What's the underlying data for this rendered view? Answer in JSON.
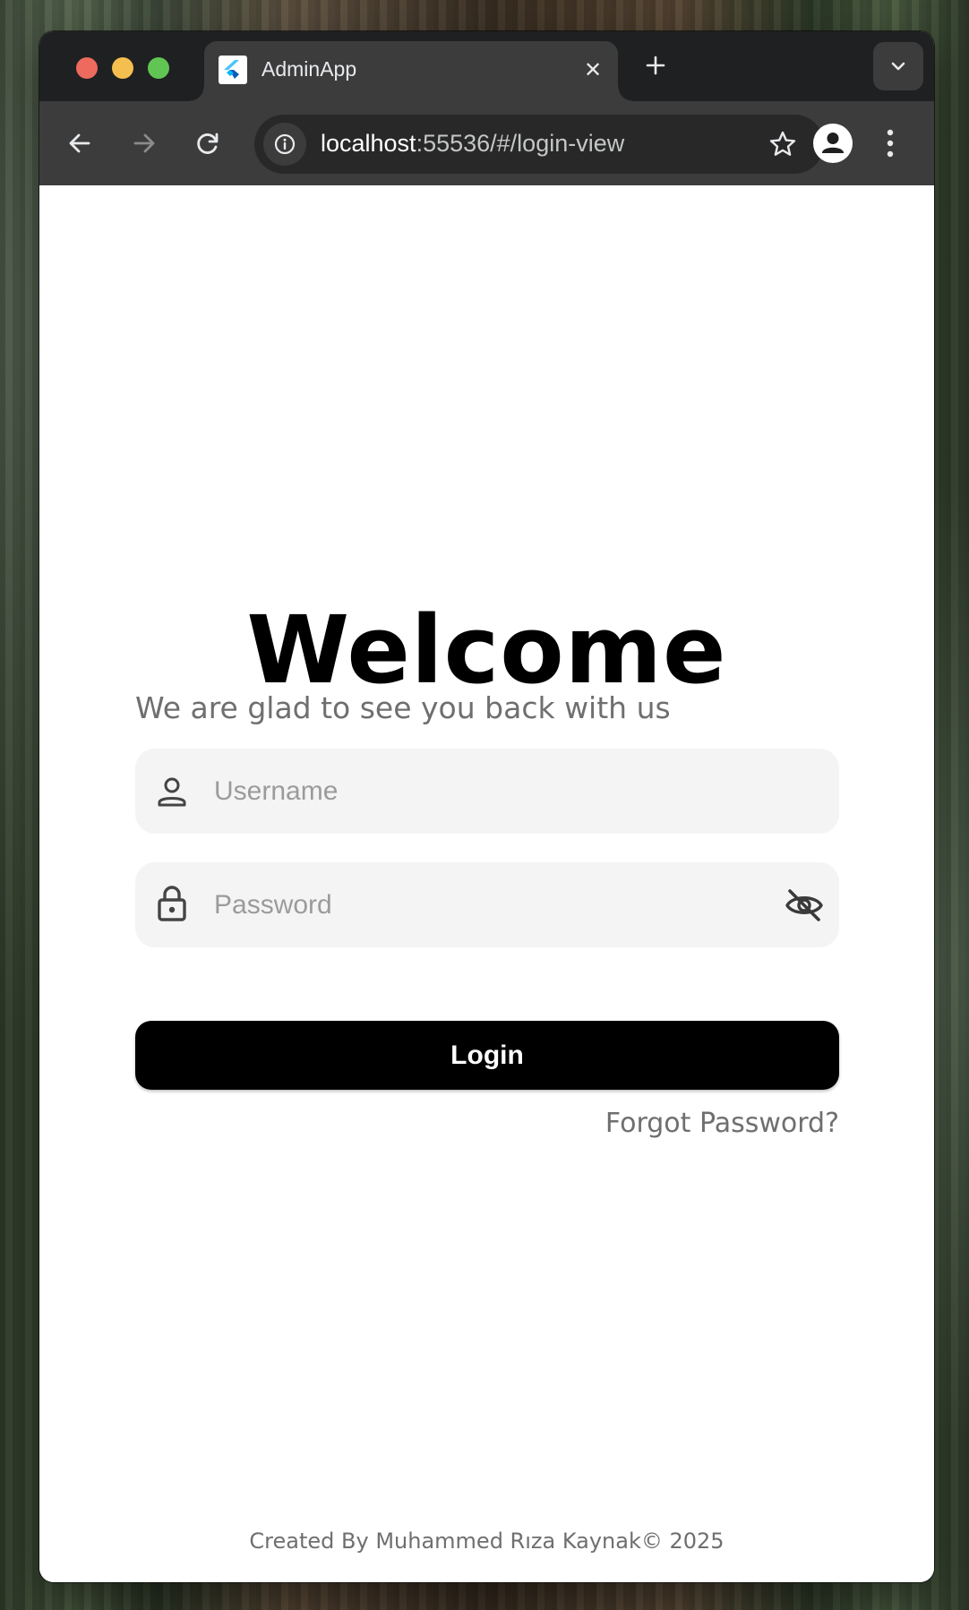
{
  "browser": {
    "tab": {
      "title": "AdminApp",
      "close_glyph": "✕",
      "favicon": "flutter-icon"
    },
    "new_tab_icon": "plus-icon",
    "tab_search_icon": "chevron-down-icon",
    "toolbar": {
      "back_icon": "arrow-left-icon",
      "forward_icon": "arrow-right-icon",
      "reload_icon": "reload-icon",
      "site_info_icon": "info-icon",
      "bookmark_icon": "star-icon",
      "profile_icon": "profile-icon",
      "menu_icon": "kebab-menu-icon"
    },
    "address": {
      "host": "localhost",
      "rest": ":55536/#/login-view"
    }
  },
  "login": {
    "title": "Welcome",
    "subtitle": "We are glad to see you back with us",
    "username": {
      "placeholder": "Username",
      "value": "",
      "icon": "person-icon"
    },
    "password": {
      "placeholder": "Password",
      "value": "",
      "icon": "lock-icon",
      "toggle_icon": "eye-off-icon"
    },
    "login_button": "Login",
    "forgot_password": "Forgot Password?"
  },
  "footer": {
    "credit": "Created By Muhammed Rıza Kaynak© 2025"
  },
  "colors": {
    "tabstrip": "#1f2021",
    "toolbar": "#3c3c3c",
    "omnibox": "#282828",
    "field_background": "#f4f4f4",
    "button": "#000000",
    "muted_text": "#6f6f6f",
    "traffic_red": "#ed6a5e",
    "traffic_yellow": "#f5bf4f",
    "traffic_green": "#61c554"
  }
}
